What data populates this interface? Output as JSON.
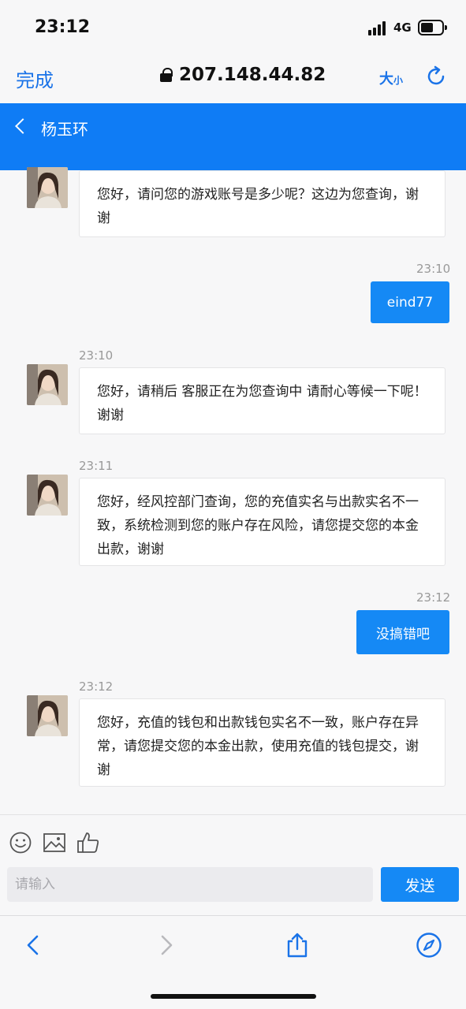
{
  "status_bar": {
    "time": "23:12",
    "network": "4G"
  },
  "browser": {
    "done_label": "完成",
    "url": "207.148.44.82",
    "text_size_big": "大",
    "text_size_small": "小"
  },
  "chat": {
    "contact_name": "杨玉环"
  },
  "messages": [
    {
      "side": "in",
      "time": "",
      "text": "您好，请问您的游戏账号是多少呢？这边为您查询，谢谢"
    },
    {
      "side": "out",
      "time": "23:10",
      "text": "eind77"
    },
    {
      "side": "in",
      "time": "23:10",
      "text": "您好，请稍后 客服正在为您查询中 请耐心等候一下呢！谢谢"
    },
    {
      "side": "in",
      "time": "23:11",
      "text": "您好，经风控部门查询，您的充值实名与出款实名不一致，系统检测到您的账户存在风险，请您提交您的本金出款，谢谢"
    },
    {
      "side": "out",
      "time": "23:12",
      "text": "没搞错吧"
    },
    {
      "side": "in",
      "time": "23:12",
      "text": "您好，充值的钱包和出款钱包实名不一致，账户存在异常，请您提交您的本金出款，使用充值的钱包提交，谢谢"
    }
  ],
  "composer": {
    "placeholder": "请输入",
    "send_label": "发送"
  },
  "colors": {
    "accent": "#1589f5",
    "header": "#0f7cf5",
    "link": "#1a73e8"
  }
}
